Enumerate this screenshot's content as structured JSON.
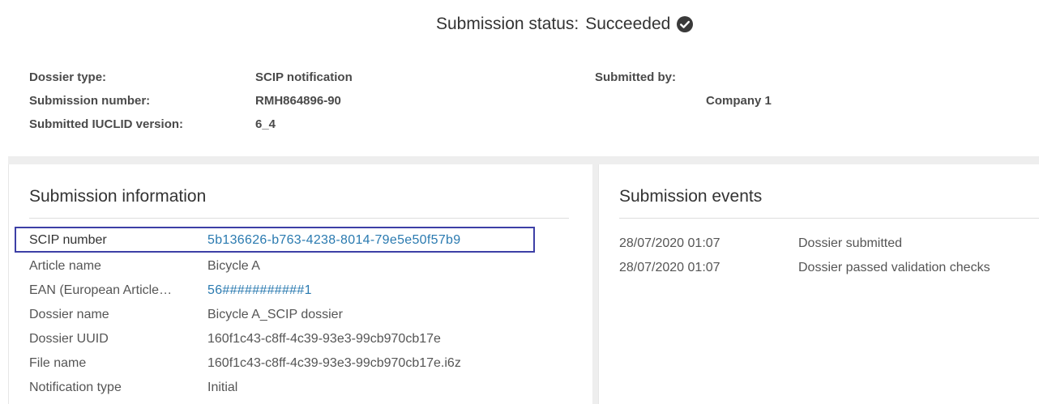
{
  "status": {
    "label": "Submission status:",
    "value": "Succeeded",
    "icon": "check-circle-icon"
  },
  "meta": {
    "dossier_type_label": "Dossier type:",
    "dossier_type_value": "SCIP notification",
    "submission_number_label": "Submission number:",
    "submission_number_value": "RMH864896-90",
    "iuclid_version_label": "Submitted IUCLID version:",
    "iuclid_version_value": "6_4",
    "submitted_by_label": "Submitted by:",
    "submitted_by_value": "Company 1"
  },
  "submission_information": {
    "title": "Submission information",
    "rows": [
      {
        "label": "SCIP number",
        "value": "5b136626-b763-4238-8014-79e5e50f57b9"
      },
      {
        "label": "Article name",
        "value": "Bicycle A"
      },
      {
        "label": "EAN (European Article…",
        "value": "56###########1"
      },
      {
        "label": "Dossier name",
        "value": "Bicycle A_SCIP dossier"
      },
      {
        "label": "Dossier UUID",
        "value": "160f1c43-c8ff-4c39-93e3-99cb970cb17e"
      },
      {
        "label": "File name",
        "value": "160f1c43-c8ff-4c39-93e3-99cb970cb17e.i6z"
      },
      {
        "label": "Notification type",
        "value": "Initial"
      }
    ]
  },
  "submission_events": {
    "title": "Submission events",
    "events": [
      {
        "date": "28/07/2020 01:07",
        "text": "Dossier submitted"
      },
      {
        "date": "28/07/2020 01:07",
        "text": "Dossier passed validation checks"
      }
    ]
  },
  "colors": {
    "link": "#2a7ab0",
    "highlight": "#3d3fa6",
    "background_band": "#eeeeee"
  }
}
